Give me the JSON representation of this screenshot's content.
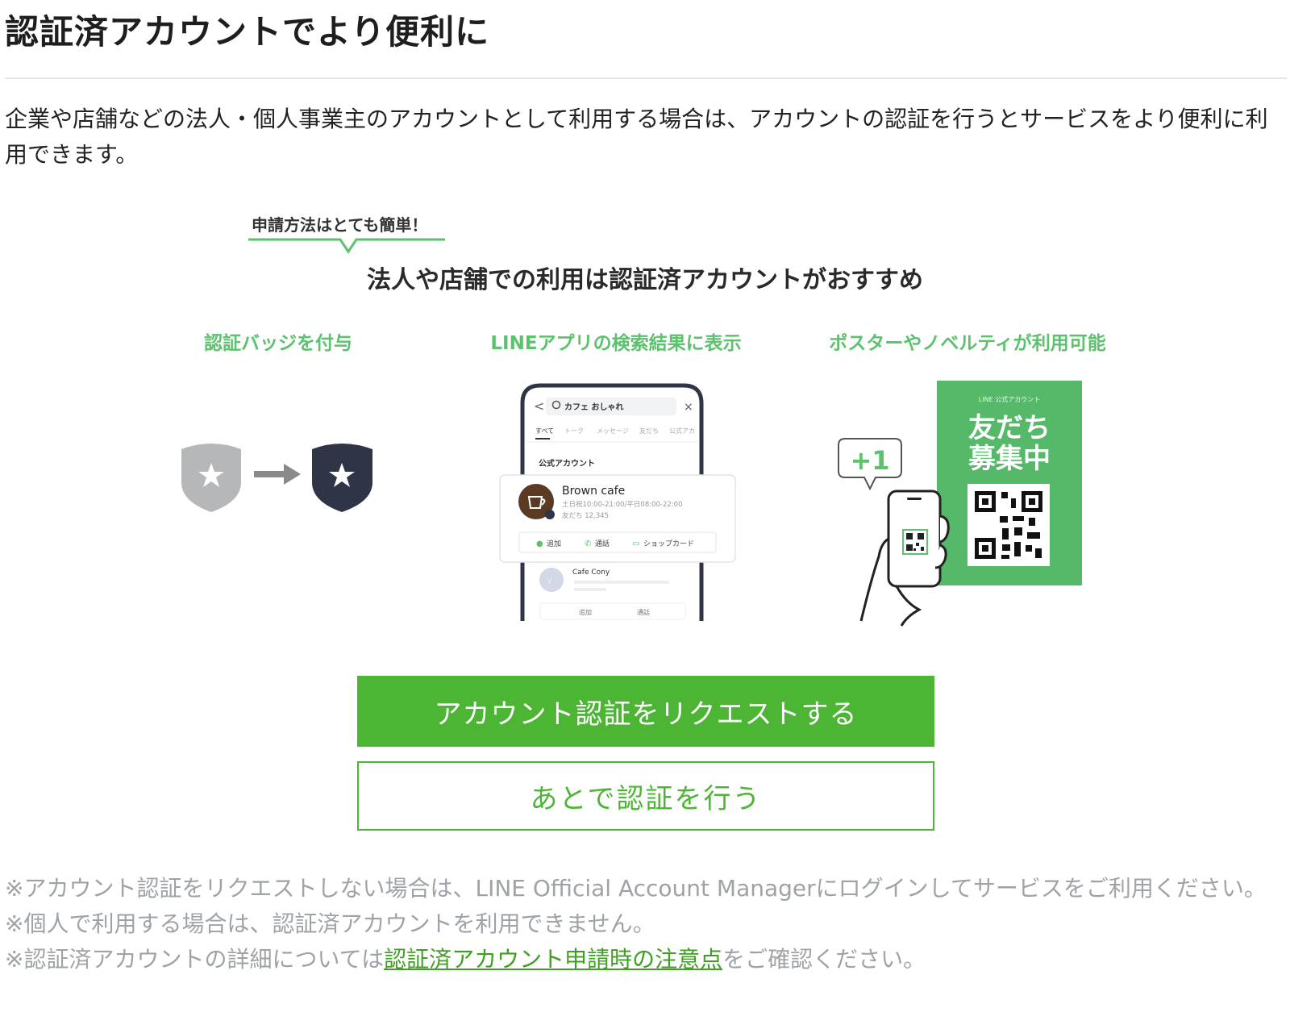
{
  "header": {
    "title": "認証済アカウントでより便利に"
  },
  "intro": {
    "text": "企業や店舗などの法人・個人事業主のアカウントとして利用する場合は、アカウントの認証を行うとサービスをより便利に利用できます。"
  },
  "illustration": {
    "callout": "申請方法はとても簡単！",
    "heading": "法人や店舗での利用は認証済アカウントがおすすめ",
    "features": [
      {
        "label": "認証バッジを付与"
      },
      {
        "label": "LINEアプリの検索結果に表示"
      },
      {
        "label": "ポスターやノベルティが利用可能"
      }
    ],
    "phone": {
      "search_text": "カフェ おしゃれ",
      "tabs": [
        "すべて",
        "トーク",
        "メッセージ",
        "友だち",
        "公式アカ"
      ],
      "section_label": "公式アカウント",
      "card": {
        "name": "Brown cafe",
        "hours": "土日祝10:00-21:00/平日08:00-22:00",
        "friends": "友だち 12,345",
        "action_add": "追加",
        "action_call": "通話",
        "action_shopcard": "ショップカード"
      },
      "second": {
        "name": "Cafe Cony",
        "action_add": "追加",
        "action_call": "通話"
      }
    },
    "poster": {
      "small_label": "LINE 公式アカウント",
      "line1": "友だち",
      "line2": "募集中",
      "plus": "+1"
    },
    "colors": {
      "green": "#4cb534",
      "poster_green": "#56b96a",
      "badge_gray": "#b5b7b9",
      "badge_navy": "#2f3547"
    }
  },
  "actions": {
    "primary_label": "アカウント認証をリクエストする",
    "secondary_label": "あとで認証を行う"
  },
  "notes": {
    "line1": "※アカウント認証をリクエストしない場合は、LINE Official Account Managerにログインしてサービスをご利用ください。",
    "line2": "※個人で利用する場合は、認証済アカウントを利用できません。",
    "line3_prefix": "※認証済アカウントの詳細については",
    "line3_link": "認証済アカウント申請時の注意点",
    "line3_suffix": "をご確認ください。"
  }
}
